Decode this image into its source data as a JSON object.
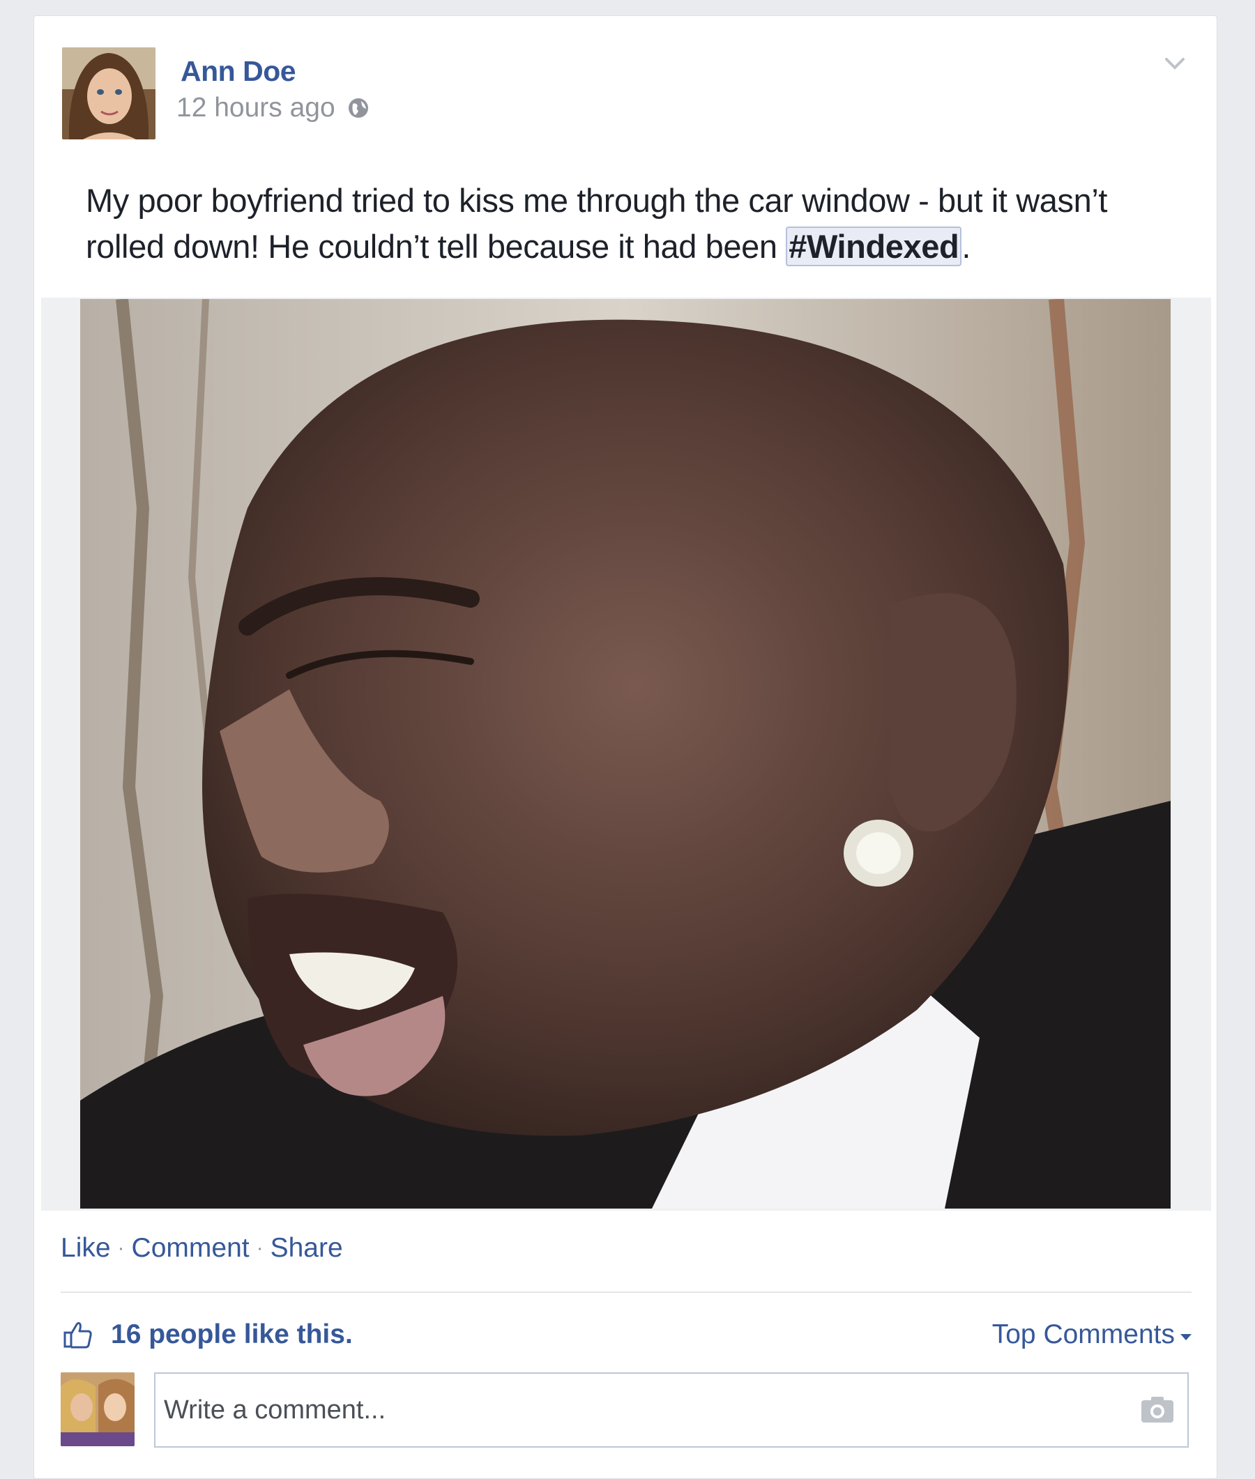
{
  "post": {
    "author": "Ann Doe",
    "timestamp": "12 hours ago",
    "privacy_icon": "globe-icon",
    "text_before": "My poor boyfriend tried to kiss me through the car window - but it wasn’t rolled down! He couldn’t tell because it had been ",
    "hashtag": "#Windexed",
    "text_after": ".",
    "options_icon": "chevron-down-icon"
  },
  "actions": {
    "like": "Like",
    "comment": "Comment",
    "share": "Share",
    "separator": "·"
  },
  "reactions": {
    "icon": "thumbs-up-icon",
    "summary": "16 people like this.",
    "sort_label": "Top Comments"
  },
  "comment_box": {
    "placeholder": "Write a comment...",
    "attach_icon": "camera-icon"
  },
  "colors": {
    "link": "#365899",
    "text": "#1d2129",
    "meta": "#90949c",
    "background": "#e9ebee"
  }
}
